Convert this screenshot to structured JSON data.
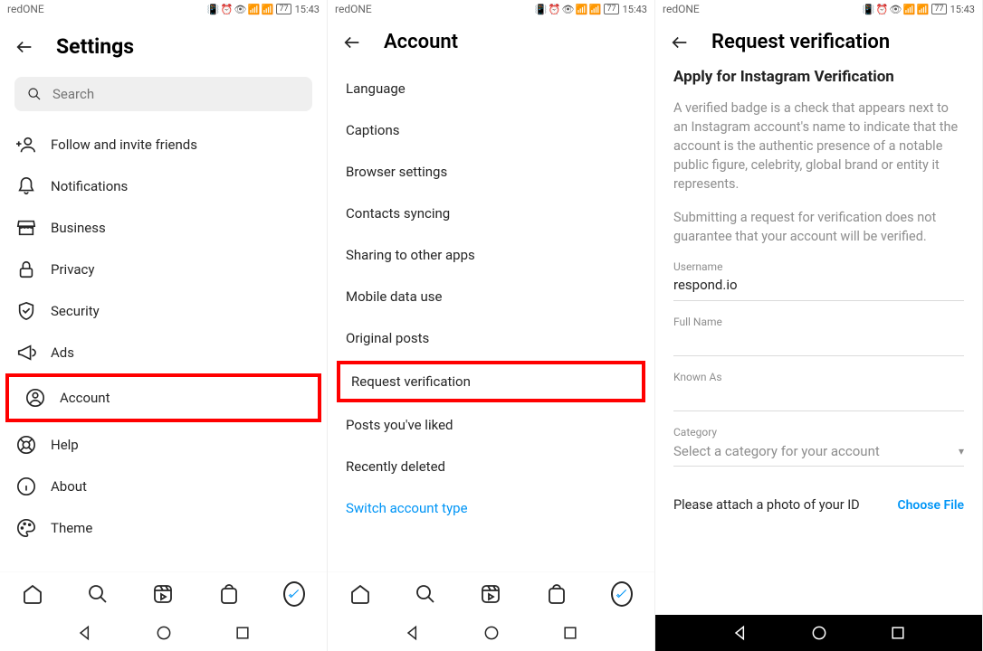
{
  "status": {
    "carrier": "redONE",
    "time": "15:43",
    "battery": "77"
  },
  "panel1": {
    "title": "Settings",
    "search_placeholder": "Search",
    "items": [
      {
        "label": "Follow and invite friends"
      },
      {
        "label": "Notifications"
      },
      {
        "label": "Business"
      },
      {
        "label": "Privacy"
      },
      {
        "label": "Security"
      },
      {
        "label": "Ads"
      },
      {
        "label": "Account"
      },
      {
        "label": "Help"
      },
      {
        "label": "About"
      },
      {
        "label": "Theme"
      }
    ]
  },
  "panel2": {
    "title": "Account",
    "items": [
      "Language",
      "Captions",
      "Browser settings",
      "Contacts syncing",
      "Sharing to other apps",
      "Mobile data use",
      "Original posts",
      "Request verification",
      "Posts you've liked",
      "Recently deleted",
      "Switch account type"
    ]
  },
  "panel3": {
    "title": "Request verification",
    "subtitle": "Apply for Instagram Verification",
    "desc1": "A verified badge is a check that appears next to an Instagram account's name to indicate that the account is the authentic presence of a notable public figure, celebrity, global brand or entity it represents.",
    "desc2": "Submitting a request for verification does not guarantee that your account will be verified.",
    "fields": {
      "username_label": "Username",
      "username_value": "respond.io",
      "fullname_label": "Full Name",
      "knownas_label": "Known As",
      "category_label": "Category",
      "category_placeholder": "Select a category for your account",
      "attach_text": "Please attach a photo of your ID",
      "choose_file": "Choose File"
    }
  }
}
